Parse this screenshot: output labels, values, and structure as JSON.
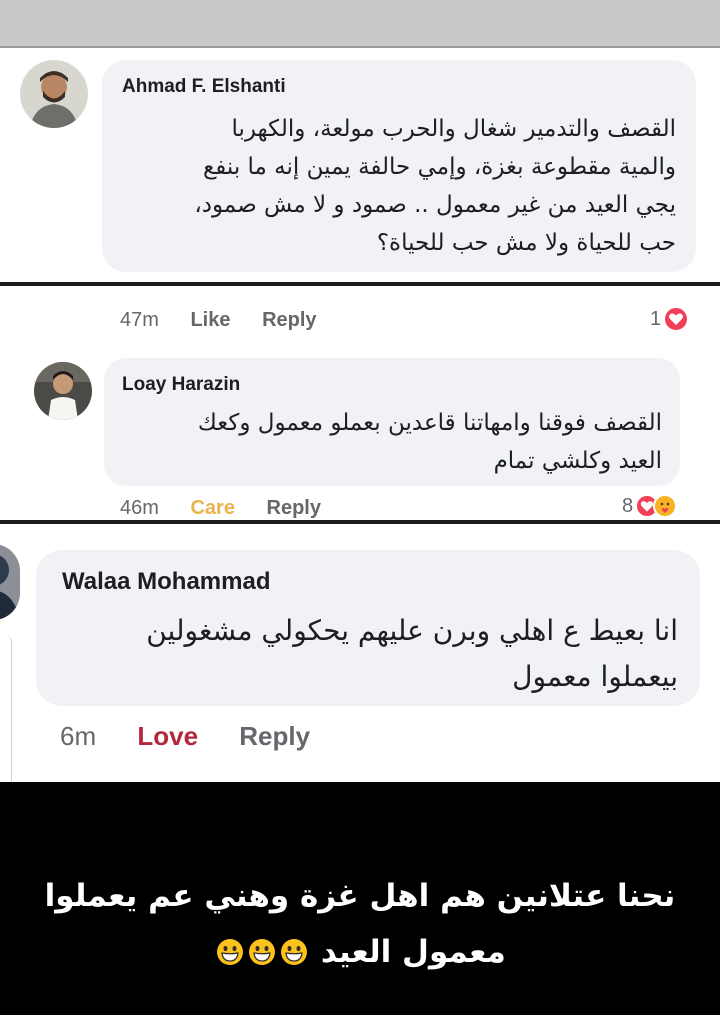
{
  "comments": [
    {
      "author": "Ahmad F. Elshanti",
      "lines": [
        "القصف والتدمير شغال والحرب مولعة، والكهربا",
        "والمية مقطوعة بغزة، وإمي حالفة يمين إنه ما بنفع",
        "يجي العيد من غير معمول .. صمود و لا مش صمود،",
        "حب للحياة ولا مش حب للحياة؟"
      ],
      "time": "47m",
      "reaction_label": "Like",
      "reply_label": "Reply",
      "reaction_count": "1",
      "reaction_color": "#f33e58"
    },
    {
      "author": "Loay Harazin",
      "lines": [
        "القصف فوقنا وامهاتنا قاعدين بعملو معمول وكعك",
        "العيد  وكلشي تمام"
      ],
      "time": "46m",
      "reaction_label": "Care",
      "reply_label": "Reply",
      "reaction_count": "8",
      "reaction_label_color": "#e9b44c"
    },
    {
      "author": "Walaa Mohammad",
      "lines": [
        "انا بعيط ع اهلي وبرن عليهم يحكولي مشغولين",
        "بيعملوا معمول"
      ],
      "time": "6m",
      "reaction_label": "Love",
      "reply_label": "Reply",
      "reaction_label_color": "#b3283d"
    }
  ],
  "caption": {
    "text": "نحنا عتلانين هم اهل غزة وهني عم يعملوا معمول العيد",
    "emojis": [
      "grinning-face-emoji",
      "grinning-face-emoji",
      "grinning-face-emoji"
    ]
  }
}
